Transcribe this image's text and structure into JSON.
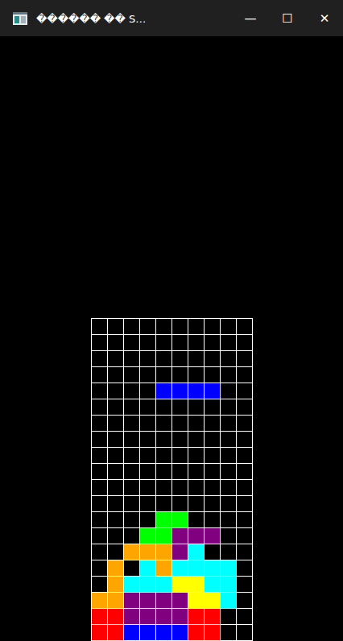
{
  "window": {
    "title": "������ �� S…",
    "controls": [
      "—",
      "☐",
      "✕"
    ]
  },
  "board": {
    "rows": [
      [
        null,
        null,
        null,
        null,
        null,
        null,
        null,
        null,
        null,
        null
      ],
      [
        null,
        null,
        null,
        null,
        null,
        null,
        null,
        null,
        null,
        null
      ],
      [
        null,
        null,
        null,
        null,
        null,
        null,
        null,
        null,
        null,
        null
      ],
      [
        null,
        null,
        null,
        null,
        null,
        null,
        null,
        null,
        null,
        null
      ],
      [
        null,
        null,
        null,
        null,
        "#0000ff",
        "#0000ff",
        "#0000ff",
        "#0000ff",
        null,
        null
      ],
      [
        null,
        null,
        null,
        null,
        null,
        null,
        null,
        null,
        null,
        null
      ],
      [
        null,
        null,
        null,
        null,
        null,
        null,
        null,
        null,
        null,
        null
      ],
      [
        null,
        null,
        null,
        null,
        null,
        null,
        null,
        null,
        null,
        null
      ],
      [
        null,
        null,
        null,
        null,
        null,
        null,
        null,
        null,
        null,
        null
      ],
      [
        null,
        null,
        null,
        null,
        null,
        null,
        null,
        null,
        null,
        null
      ],
      [
        null,
        null,
        null,
        null,
        null,
        null,
        null,
        null,
        null,
        null
      ],
      [
        null,
        null,
        null,
        null,
        null,
        null,
        null,
        null,
        null,
        null
      ],
      [
        null,
        null,
        null,
        null,
        "#00ff00",
        "#00ff00",
        null,
        null,
        null,
        null
      ],
      [
        null,
        null,
        null,
        "#00ff00",
        "#00ff00",
        "#800080",
        "#800080",
        "#800080",
        null,
        null
      ],
      [
        null,
        null,
        "#ffa500",
        "#ffa500",
        "#ffa500",
        "#800080",
        "#00ffff",
        null,
        null,
        null
      ],
      [
        null,
        "#ffa500",
        null,
        "#00ffff",
        "#ffa500",
        "#00ffff",
        "#00ffff",
        "#00ffff",
        "#00ffff",
        null
      ],
      [
        null,
        "#ffa500",
        "#00ffff",
        "#00ffff",
        "#00ffff",
        "#ffff00",
        "#ffff00",
        "#00ffff",
        "#00ffff",
        null
      ],
      [
        "#ffa500",
        "#ffa500",
        "#800080",
        "#800080",
        "#800080",
        "#800080",
        "#ffff00",
        "#ffff00",
        "#00ffff",
        null
      ],
      [
        "#ff0000",
        "#ff0000",
        "#800080",
        "#800080",
        "#800080",
        "#800080",
        "#ff0000",
        "#ff0000",
        null,
        null
      ],
      [
        "#ff0000",
        "#ff0000",
        "#0000ff",
        "#0000ff",
        "#0000ff",
        "#0000ff",
        "#ff0000",
        "#ff0000",
        null,
        null
      ]
    ]
  }
}
